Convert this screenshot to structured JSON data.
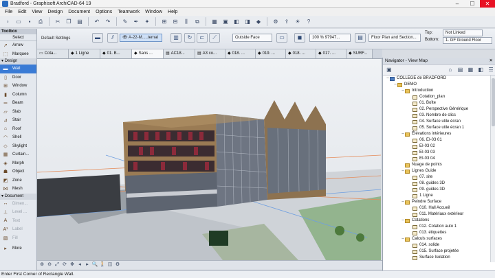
{
  "window": {
    "title": "Bradford - Graphisoft ArchiCAD-64 19",
    "minimize": "–",
    "maximize": "☐",
    "close": "✕"
  },
  "menu": [
    "File",
    "Edit",
    "View",
    "Design",
    "Document",
    "Options",
    "Teamwork",
    "Window",
    "Help"
  ],
  "toolbox": {
    "title": "Toolbox",
    "select": "Select",
    "tools_top": [
      {
        "label": "Arrow",
        "icon": "arrow-icon"
      },
      {
        "label": "Marquee",
        "icon": "marquee-icon"
      }
    ],
    "design_group": "Design",
    "design_tools": [
      {
        "label": "Wall",
        "icon": "wall-icon",
        "active": true
      },
      {
        "label": "Door",
        "icon": "door-icon"
      },
      {
        "label": "Window",
        "icon": "window-icon"
      },
      {
        "label": "Column",
        "icon": "column-icon"
      },
      {
        "label": "Beam",
        "icon": "beam-icon"
      },
      {
        "label": "Slab",
        "icon": "slab-icon"
      },
      {
        "label": "Stair",
        "icon": "stair-icon"
      },
      {
        "label": "Roof",
        "icon": "roof-icon"
      },
      {
        "label": "Shell",
        "icon": "shell-icon"
      },
      {
        "label": "Skylight",
        "icon": "skylight-icon"
      },
      {
        "label": "Curtain...",
        "icon": "curtain-wall-icon"
      },
      {
        "label": "Morph",
        "icon": "morph-icon"
      },
      {
        "label": "Object",
        "icon": "object-icon"
      },
      {
        "label": "Zone",
        "icon": "zone-icon"
      },
      {
        "label": "Mesh",
        "icon": "mesh-icon"
      }
    ],
    "document_group": "Document",
    "document_tools": [
      {
        "label": "Dimen...",
        "icon": "dimension-icon"
      },
      {
        "label": "Level ...",
        "icon": "level-dimension-icon"
      },
      {
        "label": "Text",
        "icon": "text-icon"
      },
      {
        "label": "Label",
        "icon": "label-icon"
      },
      {
        "label": "Fill",
        "icon": "fill-icon"
      }
    ],
    "more": "More"
  },
  "infobox": {
    "default_settings": "Default Settings",
    "layer": "A-22-M.....ternal",
    "reference": "Outside Face",
    "scale": "100 % 97947...",
    "floor": "Floor Plan and Section...",
    "top_label": "Top:",
    "bottom_label": "Bottom:",
    "top_value": "Not Linked",
    "bottom_value": "1. GF Ground Floor"
  },
  "tabs": [
    {
      "label": "Cota...",
      "active": false
    },
    {
      "label": "1 Ligne",
      "active": false
    },
    {
      "label": "01. B...",
      "active": false
    },
    {
      "label": "Sans ...",
      "active": true
    },
    {
      "label": "AC18...",
      "active": false
    },
    {
      "label": "A3 co...",
      "active": false
    },
    {
      "label": "018. ...",
      "active": false
    },
    {
      "label": "019. ...",
      "active": false
    },
    {
      "label": "018. ...",
      "active": false
    },
    {
      "label": "017. ...",
      "active": false
    },
    {
      "label": "SURF...",
      "active": false
    }
  ],
  "navigator": {
    "title": "Navigator - View Map",
    "tree": [
      {
        "label": "COLLEGE de BRADFORD",
        "level": 0,
        "type": "proj",
        "toggle": "–"
      },
      {
        "label": "DEMO",
        "level": 1,
        "type": "folder",
        "toggle": "–"
      },
      {
        "label": "Introduction",
        "level": 2,
        "type": "folder",
        "toggle": "–"
      },
      {
        "label": "Cotation_plan",
        "level": 3,
        "type": "view",
        "toggle": ""
      },
      {
        "label": "01. Boîte",
        "level": 3,
        "type": "view",
        "toggle": ""
      },
      {
        "label": "02. Perspective Générique",
        "level": 3,
        "type": "view",
        "toggle": ""
      },
      {
        "label": "03. Nombre de clics",
        "level": 3,
        "type": "view",
        "toggle": ""
      },
      {
        "label": "04. Surface utile écran",
        "level": 3,
        "type": "view",
        "toggle": ""
      },
      {
        "label": "05. Surface utile écran 1",
        "level": 3,
        "type": "view",
        "toggle": ""
      },
      {
        "label": "Élévations intérieures",
        "level": 2,
        "type": "folder",
        "toggle": "–"
      },
      {
        "label": "06. EI-03 01",
        "level": 3,
        "type": "view",
        "toggle": ""
      },
      {
        "label": "EI-03 02",
        "level": 3,
        "type": "view",
        "toggle": ""
      },
      {
        "label": "EI-03 03",
        "level": 3,
        "type": "view",
        "toggle": ""
      },
      {
        "label": "EI-03 04",
        "level": 3,
        "type": "view",
        "toggle": ""
      },
      {
        "label": "Nuage de points",
        "level": 2,
        "type": "folder",
        "toggle": ""
      },
      {
        "label": "Lignes Guide",
        "level": 2,
        "type": "folder",
        "toggle": "–"
      },
      {
        "label": "07. site",
        "level": 3,
        "type": "view",
        "toggle": ""
      },
      {
        "label": "08. guides 3D",
        "level": 3,
        "type": "view",
        "toggle": ""
      },
      {
        "label": "09. guides 3D",
        "level": 3,
        "type": "view",
        "toggle": ""
      },
      {
        "label": "1 Ligne",
        "level": 3,
        "type": "view",
        "toggle": ""
      },
      {
        "label": "Peindre Surface",
        "level": 2,
        "type": "folder",
        "toggle": "–"
      },
      {
        "label": "010. Hall Accueil",
        "level": 3,
        "type": "view",
        "toggle": ""
      },
      {
        "label": "011. Matériaux extérieur",
        "level": 3,
        "type": "view",
        "toggle": ""
      },
      {
        "label": "Cotations",
        "level": 2,
        "type": "folder",
        "toggle": "–"
      },
      {
        "label": "012. Cotation auto 1",
        "level": 3,
        "type": "view",
        "toggle": ""
      },
      {
        "label": "013. étiquettes",
        "level": 3,
        "type": "view",
        "toggle": ""
      },
      {
        "label": "Calculs surfaces",
        "level": 2,
        "type": "folder",
        "toggle": "–"
      },
      {
        "label": "014. solide",
        "level": 3,
        "type": "view",
        "toggle": ""
      },
      {
        "label": "015. Surface projetée",
        "level": 3,
        "type": "view",
        "toggle": ""
      },
      {
        "label": "Surface Isolation",
        "level": 3,
        "type": "view",
        "toggle": ""
      }
    ]
  },
  "status": "Enter First Corner of Rectangle Wall."
}
